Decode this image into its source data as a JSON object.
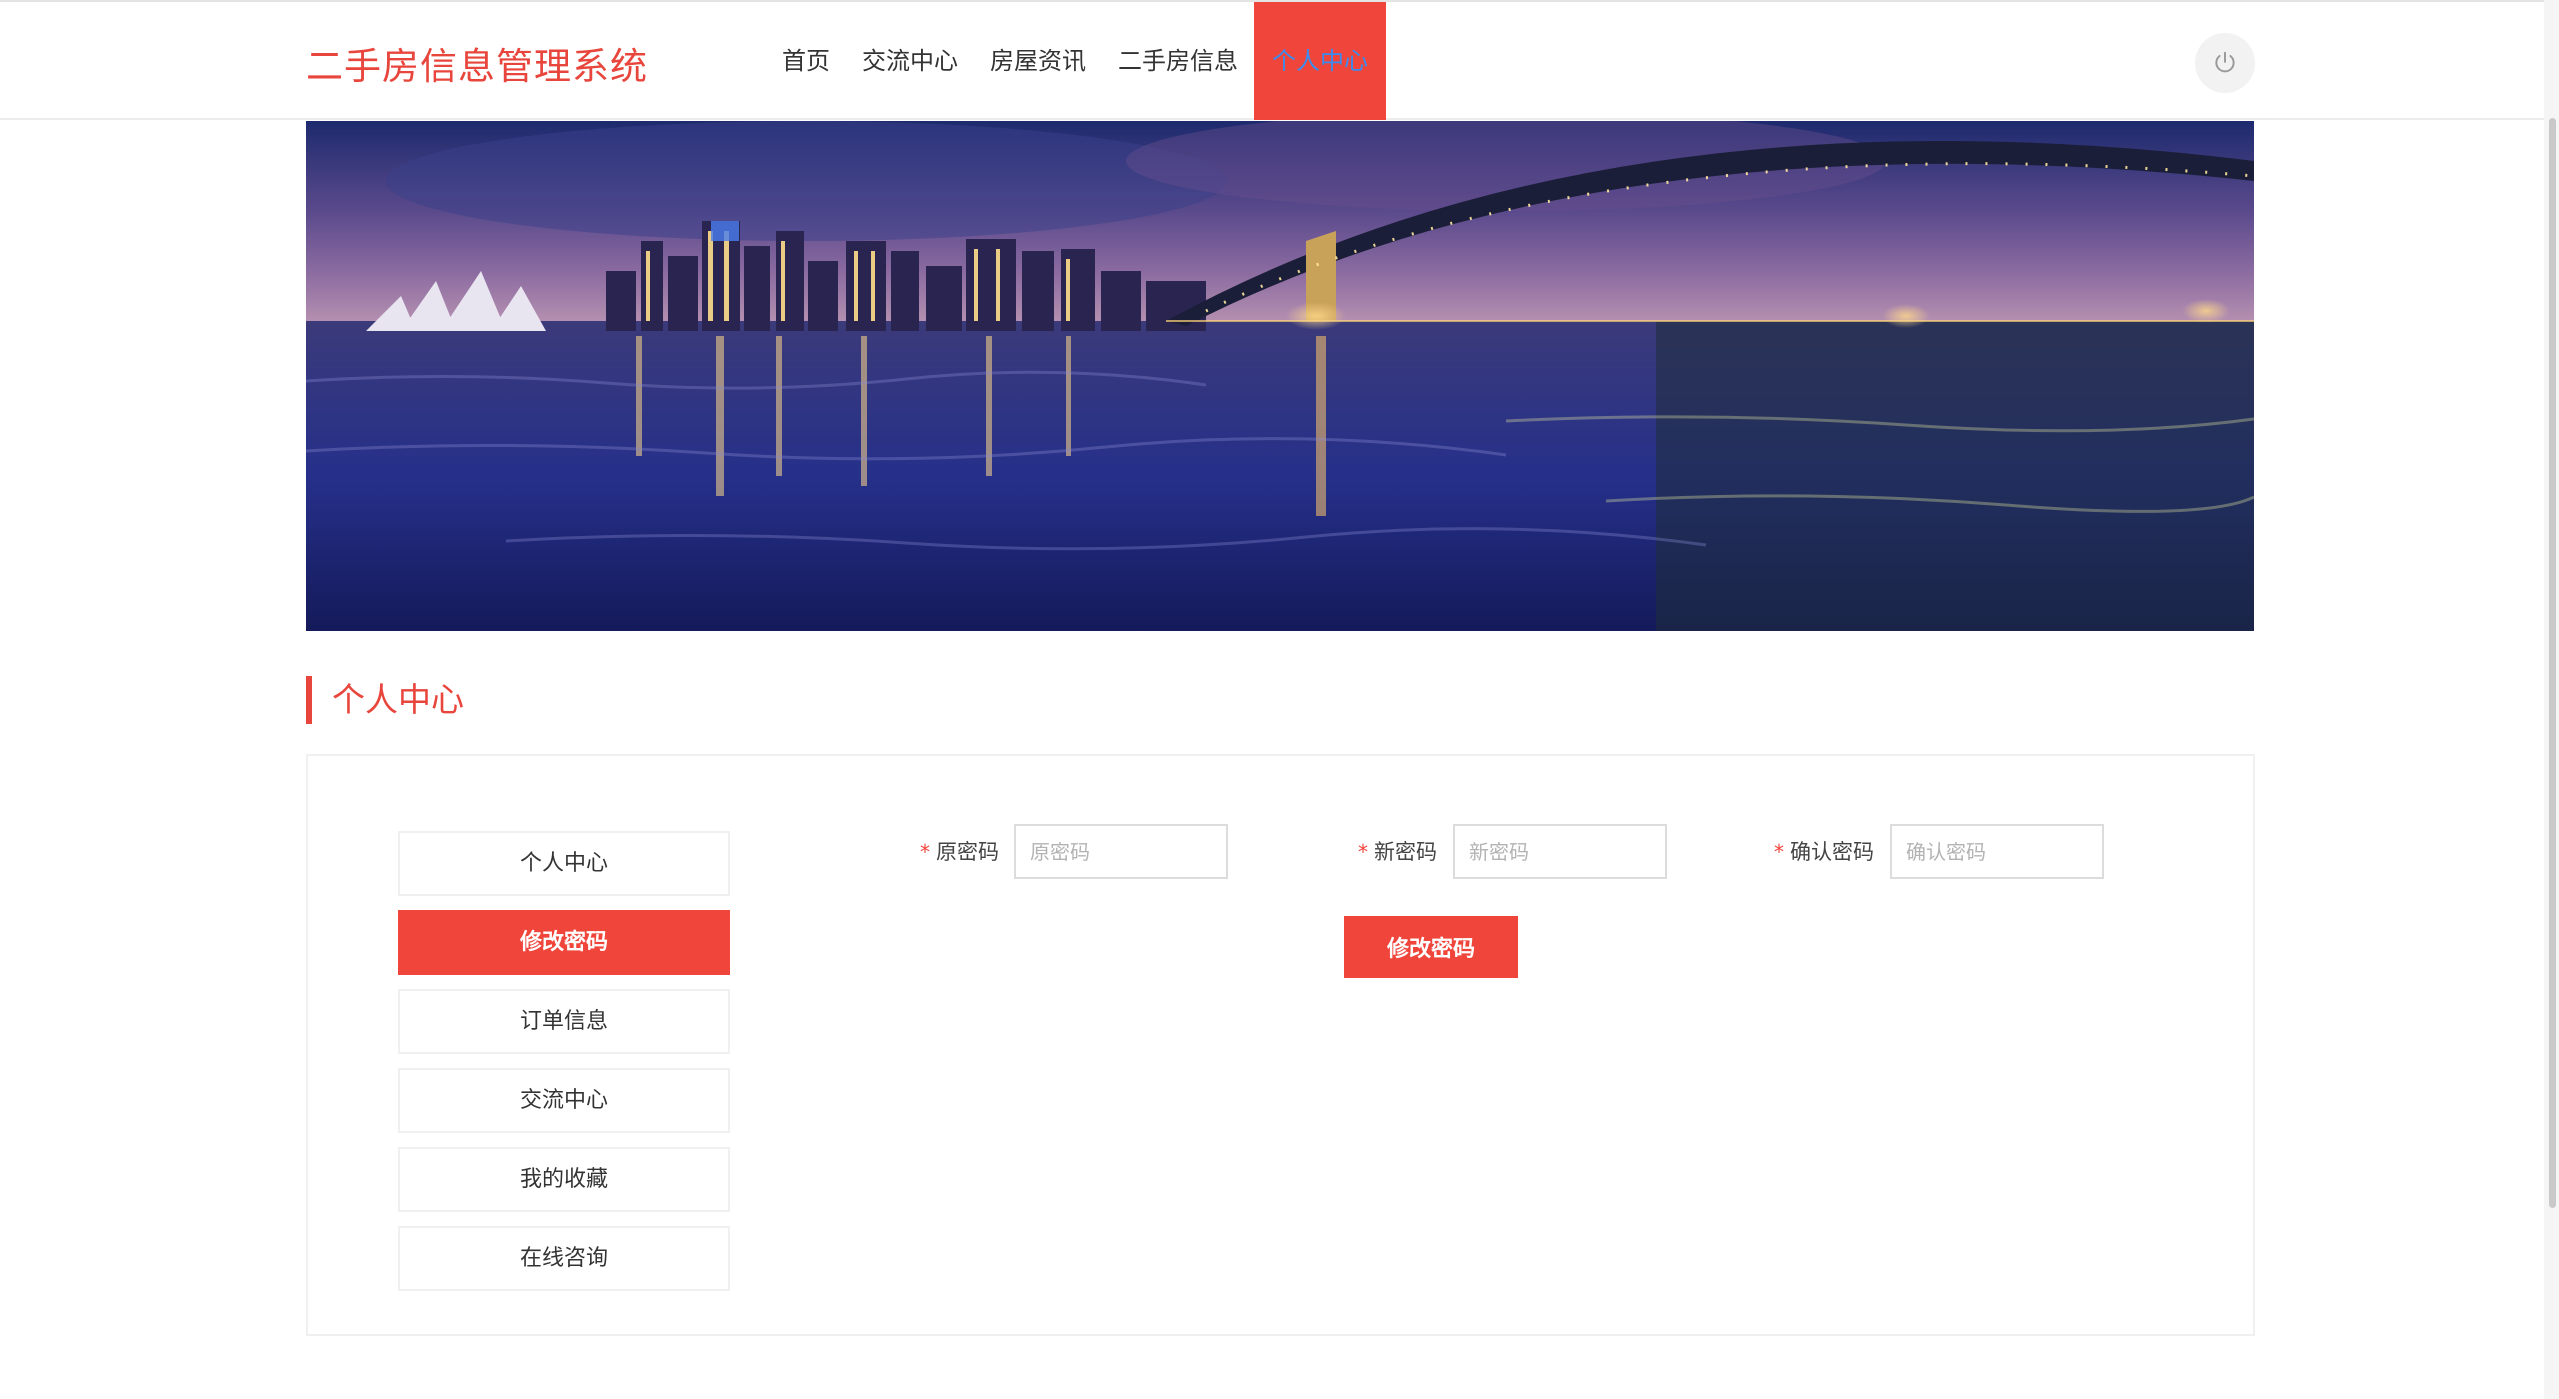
{
  "header": {
    "brand": "二手房信息管理系统",
    "nav": [
      "首页",
      "交流中心",
      "房屋资讯",
      "二手房信息",
      "个人中心"
    ],
    "active_nav": "个人中心",
    "power_icon": "power-icon"
  },
  "section": {
    "title": "个人中心"
  },
  "side_menu": {
    "items": [
      "个人中心",
      "修改密码",
      "订单信息",
      "交流中心",
      "我的收藏",
      "在线咨询"
    ],
    "active": "修改密码"
  },
  "form": {
    "required_mark": "*",
    "old_password": {
      "label": "原密码",
      "placeholder": "原密码"
    },
    "new_password": {
      "label": "新密码",
      "placeholder": "新密码"
    },
    "confirm_password": {
      "label": "确认密码",
      "placeholder": "确认密码"
    },
    "submit_label": "修改密码"
  },
  "colors": {
    "accent": "#f0453b",
    "active_nav_text": "#3a8cf0"
  }
}
